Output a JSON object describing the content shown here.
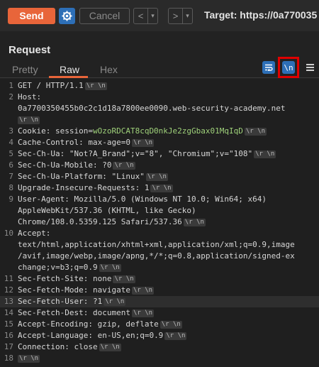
{
  "toolbar": {
    "send_label": "Send",
    "cancel_label": "Cancel",
    "back_icon": "<",
    "forward_icon": ">",
    "dropdown_icon": "▾",
    "target_label": "Target: https://0a770035"
  },
  "panel": {
    "title": "Request",
    "tabs": [
      {
        "label": "Pretty",
        "active": false
      },
      {
        "label": "Raw",
        "active": true
      },
      {
        "label": "Hex",
        "active": false
      }
    ],
    "wrap_icon_label": "wrap-lines-icon",
    "newline_icon_label": "\\n"
  },
  "crlf": "\\r \\n",
  "lines": [
    {
      "n": "1",
      "text": "GET / HTTP/1.1"
    },
    {
      "n": "2",
      "text": "Host:"
    },
    {
      "n": "",
      "text": "0a7700350455b0c2c1d18a7800ee0090.web-security-academy.net"
    },
    {
      "n": "3",
      "key": "Cookie",
      "value": "session=",
      "cookie": "wOzoRDCAT8cqD0nkJe2zgGbax01MqIqD"
    },
    {
      "n": "4",
      "key": "Cache-Control",
      "value": "max-age=0"
    },
    {
      "n": "5",
      "key": "Sec-Ch-Ua",
      "value": "\"Not?A_Brand\";v=\"8\", \"Chromium\";v=\"108\""
    },
    {
      "n": "6",
      "key": "Sec-Ch-Ua-Mobile",
      "value": "?0"
    },
    {
      "n": "7",
      "key": "Sec-Ch-Ua-Platform",
      "value": "\"Linux\""
    },
    {
      "n": "8",
      "key": "Upgrade-Insecure-Requests",
      "value": "1"
    },
    {
      "n": "9",
      "key": "User-Agent",
      "value": "Mozilla/5.0 (Windows NT 10.0; Win64; x64)"
    },
    {
      "n": "",
      "text": "AppleWebKit/537.36 (KHTML, like Gecko)"
    },
    {
      "n": "",
      "text": "Chrome/108.0.5359.125 Safari/537.36"
    },
    {
      "n": "10",
      "key": "Accept",
      "value": ""
    },
    {
      "n": "",
      "text": "text/html,application/xhtml+xml,application/xml;q=0.9,image"
    },
    {
      "n": "",
      "text": "/avif,image/webp,image/apng,*/*;q=0.8,application/signed-ex"
    },
    {
      "n": "",
      "text": "change;v=b3;q=0.9"
    },
    {
      "n": "11",
      "key": "Sec-Fetch-Site",
      "value": "none"
    },
    {
      "n": "12",
      "key": "Sec-Fetch-Mode",
      "value": "navigate"
    },
    {
      "n": "13",
      "key": "Sec-Fetch-User",
      "value": "?1"
    },
    {
      "n": "14",
      "key": "Sec-Fetch-Dest",
      "value": "document"
    },
    {
      "n": "15",
      "key": "Accept-Encoding",
      "value": "gzip, deflate"
    },
    {
      "n": "16",
      "key": "Accept-Language",
      "value": "en-US,en;q=0.9"
    },
    {
      "n": "17",
      "key": "Connection",
      "value": "close"
    },
    {
      "n": "18",
      "text": ""
    }
  ],
  "colors": {
    "accent": "#e8653a",
    "blue": "#2d6fb7",
    "cookie": "#9fd17a",
    "highlight": "#e00000"
  }
}
